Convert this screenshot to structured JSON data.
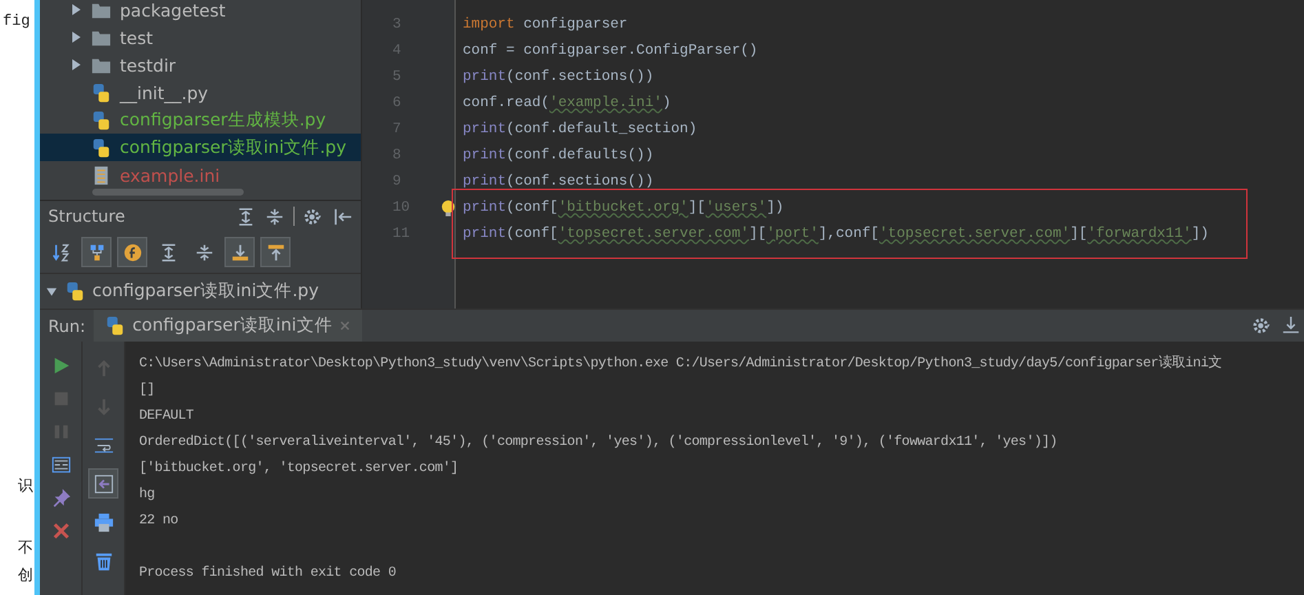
{
  "background_page": {
    "fragments": [
      "fig",
      "识",
      "不",
      "创"
    ]
  },
  "project_tree": {
    "items": [
      {
        "name": "packagetest",
        "kind": "folder",
        "selected": false
      },
      {
        "name": "test",
        "kind": "folder",
        "selected": false
      },
      {
        "name": "testdir",
        "kind": "folder",
        "selected": false
      },
      {
        "name": "__init__.py",
        "kind": "python",
        "selected": false
      },
      {
        "name": "configparser生成模块.py",
        "kind": "python",
        "selected": false,
        "color": "#62b543"
      },
      {
        "name": "configparser读取ini文件.py",
        "kind": "python",
        "selected": true,
        "color": "#62b543"
      },
      {
        "name": "example.ini",
        "kind": "ini",
        "selected": false,
        "color": "#c0504d"
      }
    ]
  },
  "structure": {
    "title": "Structure",
    "header_tools": [
      {
        "kind": "expand"
      },
      {
        "kind": "collapse"
      },
      {
        "kind": "gear"
      },
      {
        "kind": "hide"
      }
    ],
    "toolbar": [
      {
        "kind": "sort",
        "on": false
      },
      {
        "kind": "inherited",
        "on": true
      },
      {
        "kind": "fields",
        "on": true
      },
      {
        "kind": "expand",
        "on": false
      },
      {
        "kind": "collapse",
        "on": false
      },
      {
        "kind": "scroll-to",
        "on": true
      },
      {
        "kind": "scroll-from",
        "on": true
      }
    ],
    "root": {
      "name": "configparser读取ini文件.py",
      "expanded": true
    }
  },
  "editor": {
    "lines": [
      {
        "number": "3",
        "segments": [
          {
            "kind": "keyword",
            "text": "import"
          },
          {
            "kind": "plain",
            "text": " configparser"
          }
        ]
      },
      {
        "number": "4",
        "segments": [
          {
            "kind": "plain",
            "text": "conf = configparser.ConfigParser()"
          }
        ]
      },
      {
        "number": "5",
        "segments": [
          {
            "kind": "builtin",
            "text": "print"
          },
          {
            "kind": "plain",
            "text": "(conf.sections())"
          }
        ]
      },
      {
        "number": "6",
        "segments": [
          {
            "kind": "plain",
            "text": "conf.read("
          },
          {
            "kind": "string",
            "text": "'example.ini'"
          },
          {
            "kind": "plain",
            "text": ")"
          }
        ]
      },
      {
        "number": "7",
        "segments": [
          {
            "kind": "builtin",
            "text": "print"
          },
          {
            "kind": "plain",
            "text": "(conf.default_section)"
          }
        ]
      },
      {
        "number": "8",
        "segments": [
          {
            "kind": "builtin",
            "text": "print"
          },
          {
            "kind": "plain",
            "text": "(conf.defaults())"
          }
        ]
      },
      {
        "number": "9",
        "segments": [
          {
            "kind": "builtin",
            "text": "print"
          },
          {
            "kind": "plain",
            "text": "(conf.sections())"
          }
        ]
      },
      {
        "number": "10",
        "bulb": true,
        "segments": [
          {
            "kind": "builtin",
            "text": "print"
          },
          {
            "kind": "plain",
            "text": "(conf["
          },
          {
            "kind": "string",
            "text": "'bitbucket.org'"
          },
          {
            "kind": "plain",
            "text": "]["
          },
          {
            "kind": "string",
            "text": "'users'"
          },
          {
            "kind": "plain",
            "text": "])"
          }
        ]
      },
      {
        "number": "11",
        "segments": [
          {
            "kind": "builtin",
            "text": "print"
          },
          {
            "kind": "plain",
            "text": "(conf["
          },
          {
            "kind": "string",
            "text": "'topsecret.server.com'"
          },
          {
            "kind": "plain",
            "text": "]["
          },
          {
            "kind": "string",
            "text": "'port'"
          },
          {
            "kind": "plain",
            "text": "],conf["
          },
          {
            "kind": "string",
            "text": "'topsecret.server.com'"
          },
          {
            "kind": "plain",
            "text": "]["
          },
          {
            "kind": "string",
            "text": "'forwardx11'"
          },
          {
            "kind": "plain",
            "text": "])"
          }
        ]
      }
    ]
  },
  "run": {
    "label": "Run:",
    "tab": "configparser读取ini文件",
    "left_tools": [
      {
        "kind": "run"
      },
      {
        "kind": "stop"
      },
      {
        "kind": "pause"
      },
      {
        "kind": "layout"
      },
      {
        "kind": "pin"
      },
      {
        "kind": "close"
      }
    ],
    "right_tools": [
      {
        "kind": "up",
        "on": false
      },
      {
        "kind": "down",
        "on": false
      },
      {
        "kind": "wrap",
        "on": false
      },
      {
        "kind": "scroll-end",
        "on": true
      },
      {
        "kind": "print",
        "on": false
      },
      {
        "kind": "trash",
        "on": false
      }
    ],
    "output": [
      "C:\\Users\\Administrator\\Desktop\\Python3_study\\venv\\Scripts\\python.exe C:/Users/Administrator/Desktop/Python3_study/day5/configparser读取ini文",
      "[]",
      "DEFAULT",
      "OrderedDict([('serveraliveinterval', '45'), ('compression', 'yes'), ('compressionlevel', '9'), ('fowwardx11', 'yes')])",
      "['bitbucket.org', 'topsecret.server.com']",
      "hg",
      "22 no"
    ],
    "exit_message": "Process finished with exit code 0"
  }
}
